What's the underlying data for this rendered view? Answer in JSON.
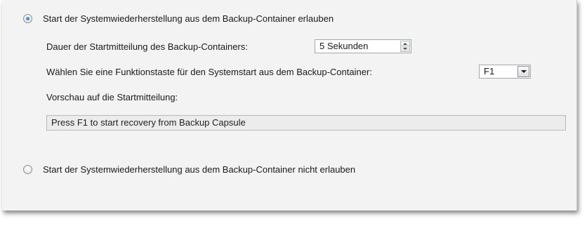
{
  "options": {
    "allow": {
      "label": "Start der Systemwiederherstellung aus dem Backup-Container erlauben",
      "selected": true
    },
    "disallow": {
      "label": "Start der Systemwiederherstellung aus dem Backup-Container nicht erlauben",
      "selected": false
    }
  },
  "duration": {
    "label": "Dauer der Startmitteilung des Backup-Containers:",
    "value": "5 Sekunden"
  },
  "function_key": {
    "label": "Wählen Sie eine Funktionstaste für den Systemstart aus dem Backup-Container:",
    "value": "F1"
  },
  "preview": {
    "label": "Vorschau auf die Startmitteilung:",
    "text": "Press F1 to start recovery from Backup Capsule"
  },
  "icons": {
    "radio_selected": "radio-selected-icon",
    "radio_unselected": "radio-unselected-icon",
    "spin_up": "arrow-up-icon",
    "spin_down": "arrow-down-icon",
    "dropdown": "chevron-down-icon"
  },
  "colors": {
    "panel_background": "#f3f3f3",
    "radio_accent": "#1f6fc4",
    "preview_background": "#ececec"
  }
}
